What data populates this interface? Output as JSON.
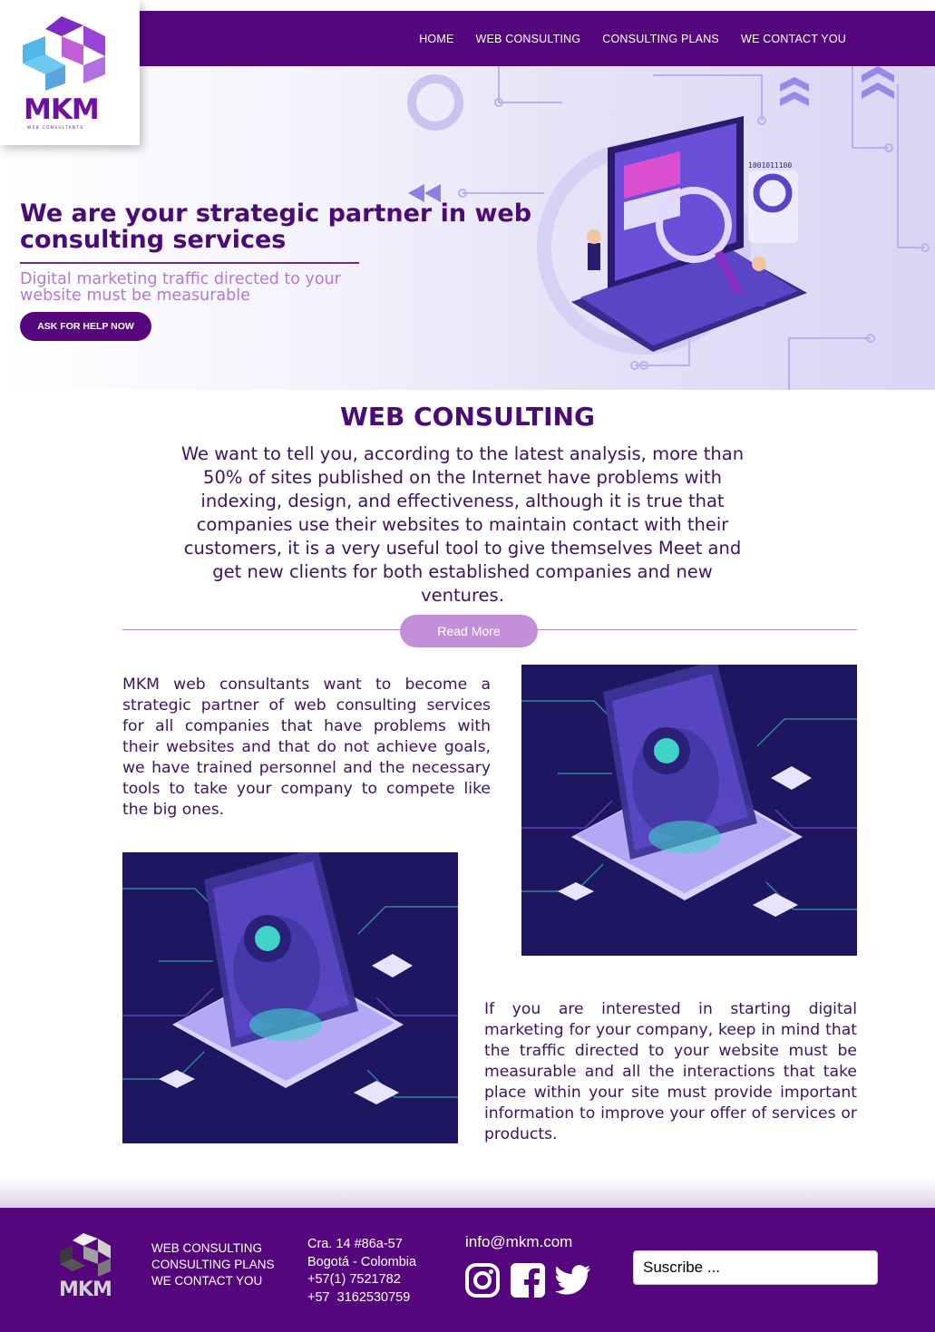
{
  "brand": {
    "name": "MKM",
    "tagline": "WEB CONSULTANTS"
  },
  "nav": {
    "items": [
      {
        "label": "HOME"
      },
      {
        "label": "WEB CONSULTING"
      },
      {
        "label": "CONSULTING PLANS"
      },
      {
        "label": "WE CONTACT YOU"
      }
    ]
  },
  "hero": {
    "title": "We are your strategic partner in web consulting services",
    "subtitle": "Digital marketing traffic directed to your website must be measurable",
    "cta_label": "ASK FOR HELP NOW"
  },
  "section": {
    "title": "WEB CONSULTING",
    "intro": "We want to tell you, according to the latest analysis, more than 50% of sites published on the Internet have problems with indexing, design, and effectiveness, although it is true that companies use their websites to maintain contact with their customers, it is a very useful tool to give themselves Meet and get new clients for both established companies and new ventures.",
    "read_more_label": "Read More",
    "paragraph_1": "MKM web consultants want to become a strategic partner of web consulting services for all companies that have problems with their websites and that do not achieve goals, we have trained personnel and the necessary tools to take your company to compete like the big ones.",
    "paragraph_2": "If you are interested in starting digital marketing for your company, keep in mind that the traffic directed to your website must be measurable and all the interactions that take place within your site must provide important information to improve your offer of services or products."
  },
  "footer": {
    "links": [
      {
        "label": "WEB CONSULTING"
      },
      {
        "label": "CONSULTING PLANS"
      },
      {
        "label": "WE CONTACT YOU"
      }
    ],
    "address": {
      "line1": "Cra. 14 #86a-57",
      "line2": "Bogotá - Colombia",
      "phone1": "+57(1) 7521782",
      "phone2": "+57  3162530759"
    },
    "email": "info@mkm.com",
    "social": [
      "instagram-icon",
      "facebook-icon",
      "twitter-icon"
    ],
    "subscribe_placeholder": "Suscribe ..."
  },
  "colors": {
    "primary": "#56067d",
    "heading": "#4a0a78",
    "accent_light": "#c38fd8",
    "subtitle": "#b27ad2"
  }
}
